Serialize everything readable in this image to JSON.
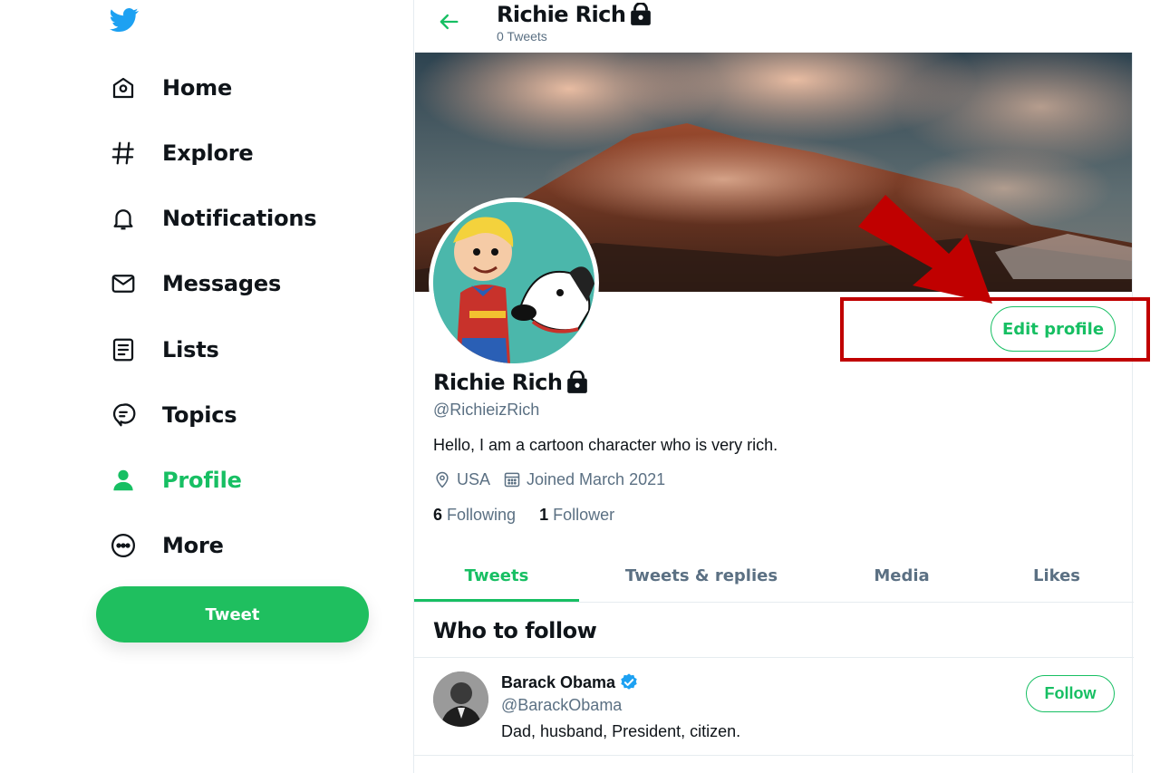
{
  "nav": {
    "items": [
      {
        "label": "Home",
        "icon": "home-icon"
      },
      {
        "label": "Explore",
        "icon": "hashtag-icon"
      },
      {
        "label": "Notifications",
        "icon": "bell-icon"
      },
      {
        "label": "Messages",
        "icon": "envelope-icon"
      },
      {
        "label": "Lists",
        "icon": "list-icon"
      },
      {
        "label": "Topics",
        "icon": "topics-icon"
      },
      {
        "label": "Profile",
        "icon": "person-icon",
        "active": true
      },
      {
        "label": "More",
        "icon": "more-icon"
      }
    ],
    "tweet_button": "Tweet"
  },
  "header": {
    "name": "Richie Rich",
    "tweet_count": "0 Tweets"
  },
  "profile": {
    "name": "Richie Rich",
    "handle": "@RichieizRich",
    "bio": "Hello, I am a cartoon character who is very rich.",
    "location": "USA",
    "joined": "Joined March 2021",
    "following_count": "6",
    "following_label": "Following",
    "followers_count": "1",
    "followers_label": "Follower",
    "edit_button": "Edit profile"
  },
  "tabs": [
    {
      "label": "Tweets",
      "active": true
    },
    {
      "label": "Tweets & replies"
    },
    {
      "label": "Media"
    },
    {
      "label": "Likes"
    }
  ],
  "who_to_follow": {
    "title": "Who to follow",
    "items": [
      {
        "name": "Barack Obama",
        "handle": "@BarackObama",
        "bio": "Dad, husband, President, citizen.",
        "button": "Follow",
        "verified": true
      }
    ]
  },
  "colors": {
    "accent": "#17bf63",
    "annotation": "#c00000",
    "muted": "#5b7083"
  }
}
